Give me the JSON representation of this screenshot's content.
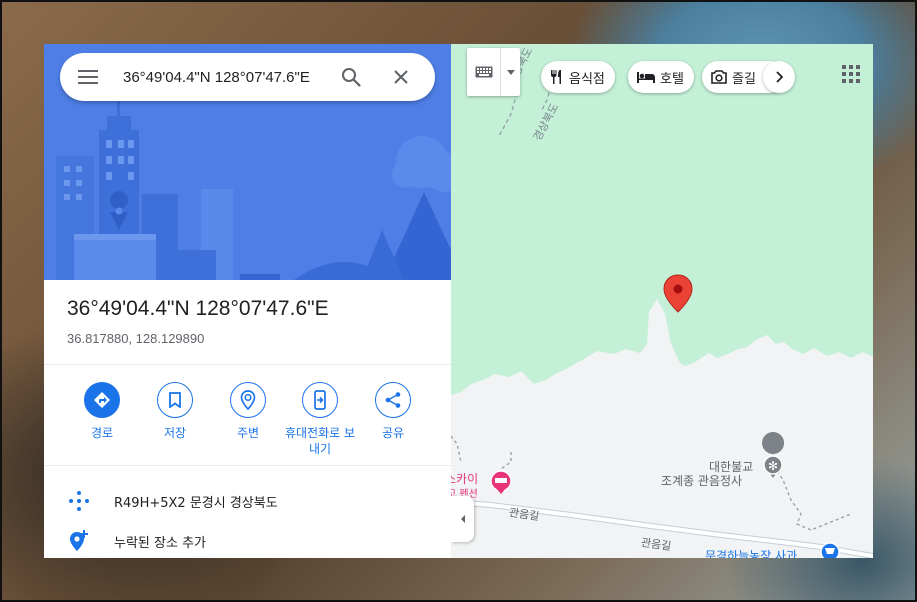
{
  "search": {
    "value": "36°49'04.4\"N 128°07'47.6\"E"
  },
  "place": {
    "title": "36°49'04.4\"N 128°07'47.6\"E",
    "decimal": "36.817880, 128.129890"
  },
  "actions": [
    {
      "label": "경로",
      "icon": "directions-icon"
    },
    {
      "label": "저장",
      "icon": "bookmark-icon"
    },
    {
      "label": "주변",
      "icon": "nearby-icon"
    },
    {
      "label": "휴대전화로 보내기",
      "icon": "send-to-phone-icon"
    },
    {
      "label": "공유",
      "icon": "share-icon"
    }
  ],
  "info": {
    "plus_code": "R49H+5X2 문경시 경상북도",
    "add_missing": "누락된 장소 추가"
  },
  "map_chips": [
    {
      "label": "음식점",
      "icon": "restaurant-icon"
    },
    {
      "label": "호텔",
      "icon": "hotel-icon"
    },
    {
      "label": "즐길",
      "icon": "camera-icon"
    }
  ],
  "map_labels": {
    "border_a": "충청북도",
    "border_b": "경상북도",
    "temple_line1": "대한불교",
    "temple_line2": "조계종 관음정사",
    "road1": "관음길",
    "road2": "관음길",
    "hotel_line1": "스카이",
    "hotel_line2": "고 펜션",
    "store": "문경하늘농장 사과"
  },
  "colors": {
    "accent": "#1a73e8",
    "hero_bg": "#4e7ee6",
    "park_green": "#c3f0d6",
    "pin_red": "#ea4335",
    "temple_text": "#5f6368",
    "hotel_pink": "#e8357a"
  }
}
